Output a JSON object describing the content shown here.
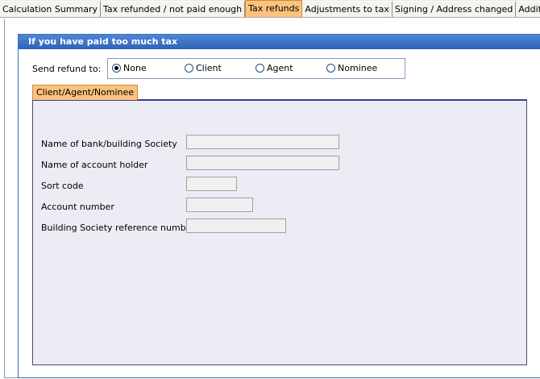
{
  "tabs": [
    {
      "label": "Calculation Summary",
      "active": false
    },
    {
      "label": "Tax refunded / not paid enough",
      "active": false
    },
    {
      "label": "Tax refunds",
      "active": true
    },
    {
      "label": "Adjustments to tax",
      "active": false
    },
    {
      "label": "Signing / Address changed",
      "active": false
    },
    {
      "label": "Additional Information",
      "active": false
    }
  ],
  "section": {
    "title": "If you have paid too much tax"
  },
  "send_refund": {
    "label": "Send refund to:",
    "options": [
      "None",
      "Client",
      "Agent",
      "Nominee"
    ],
    "selected": "None"
  },
  "inner_tab": {
    "label": "Client/Agent/Nominee"
  },
  "fields": {
    "bank_name": {
      "label": "Name of bank/building Society",
      "value": ""
    },
    "account_holder": {
      "label": "Name of account holder",
      "value": ""
    },
    "sort_code": {
      "label": "Sort code",
      "value": ""
    },
    "account_number": {
      "label": "Account number",
      "value": ""
    },
    "bs_reference": {
      "label": "Building Society reference number",
      "value": ""
    }
  },
  "colors": {
    "active_tab": "#fcc27d",
    "header": "#2e64b8",
    "panel_bg": "#ececf4"
  }
}
